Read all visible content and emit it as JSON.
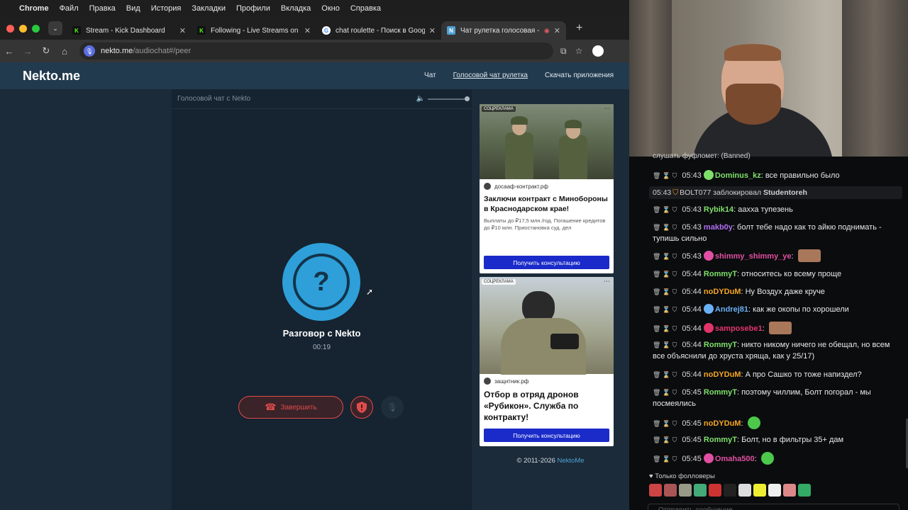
{
  "menubar": {
    "app": "Chrome",
    "items": [
      "Файл",
      "Правка",
      "Вид",
      "История",
      "Закладки",
      "Профили",
      "Вкладка",
      "Окно",
      "Справка"
    ]
  },
  "tabs": [
    {
      "title": "Stream - Kick Dashboard",
      "icon": "kick-icon",
      "active": false
    },
    {
      "title": "Following - Live Streams on Ki",
      "icon": "kick-icon",
      "active": false
    },
    {
      "title": "chat roulette - Поиск в Googl",
      "icon": "google-icon",
      "active": false
    },
    {
      "title": "Чат рулетка голосовая -",
      "icon": "nekto-icon",
      "active": true
    }
  ],
  "address": {
    "host": "nekto.me",
    "path": "/audiochat#/peer"
  },
  "site": {
    "logo": "Nekto.me",
    "nav": [
      "Чат",
      "Голосовой чат рулетка",
      "Скачать приложения"
    ],
    "chat_header": "Голосовой чат с Nekto",
    "avatar_glyph": "?",
    "conversation_title": "Разговор с Nekto",
    "timer": "00:19",
    "end_button": "Завершить",
    "copyright_prefix": "© 2011-2026 ",
    "copyright_brand": "NektoMe"
  },
  "ads": [
    {
      "badge": "СОЦРЕКЛАМА",
      "source": "досааф-контракт.рф",
      "headline": "Заключи контракт с Минобороны в Краснодарском крае!",
      "desc": "Выплаты до ₽17,5 млн./год. Погашение кредитов до ₽10 млн. Приостановка суд. дел",
      "cta": "Получить консультацию"
    },
    {
      "badge": "СОЦРЕКЛАМА",
      "source": "защитник.рф",
      "headline": "Отбор в отряд дронов «Рубикон». Служба по контракту!",
      "cta": "Получить консультацию"
    }
  ],
  "kick_chat": {
    "cut_line": "слушать фуфломет: (Banned)",
    "system": {
      "time": "05:43",
      "mod": "BOLT077",
      "action": "заблокировал",
      "target": "Studentoreh"
    },
    "messages": [
      {
        "time": "05:43",
        "user": "Dominus_kz",
        "text": ": все правильно было",
        "color": "#7ee06a",
        "badge": true
      },
      {
        "time": "05:43",
        "user": "Rybik14",
        "text": ": аахха тупезень",
        "color": "#7ee06a",
        "badge": false
      },
      {
        "time": "05:43",
        "user": "makb0y",
        "text": ": болт тебе надо как то айкю поднимать - тупишь сильно",
        "color": "#b06ef2",
        "badge": false
      },
      {
        "time": "05:43",
        "user": "shimmy_shimmy_ye",
        "text": ":",
        "color": "#e04fa2",
        "badge": true
      },
      {
        "time": "05:44",
        "user": "RommyT",
        "text": ": относитесь ко всему проще",
        "color": "#7ee06a",
        "badge": false
      },
      {
        "time": "05:44",
        "user": "noDYDuM",
        "text": ": Ну Воздух даже круче",
        "color": "#f5a623",
        "badge": false
      },
      {
        "time": "05:44",
        "user": "Andrej81",
        "text": ": как же окопы по хорошели",
        "color": "#6ab0f5",
        "badge": true
      },
      {
        "time": "05:44",
        "user": "samposebe1",
        "text": ":",
        "color": "#e0356a",
        "badge": true
      },
      {
        "time": "05:44",
        "user": "RommyT",
        "text": ": никто никому ничего не обещал, но всем все объяснили до хруста хряща, как у 25/17)",
        "color": "#7ee06a",
        "badge": false
      },
      {
        "time": "05:44",
        "user": "noDYDuM",
        "text": ": А про Сашко то тоже напиздел?",
        "color": "#f5a623",
        "badge": false
      },
      {
        "time": "05:45",
        "user": "RommyT",
        "text": ": поэтому чиллим, Болт погорал - мы посмеялись",
        "color": "#7ee06a",
        "badge": false
      },
      {
        "time": "05:45",
        "user": "noDYDuM",
        "text": ":",
        "color": "#f5a623",
        "badge": false
      },
      {
        "time": "05:45",
        "user": "RommyT",
        "text": ": Болт, но в фильтры 35+ дам",
        "color": "#7ee06a",
        "badge": false
      },
      {
        "time": "05:45",
        "user": "Omaha500",
        "text": ":",
        "color": "#e04fa2",
        "badge": true
      }
    ],
    "followers_only": "Только фолловеры",
    "input_placeholder": "Отправить сообщение"
  }
}
